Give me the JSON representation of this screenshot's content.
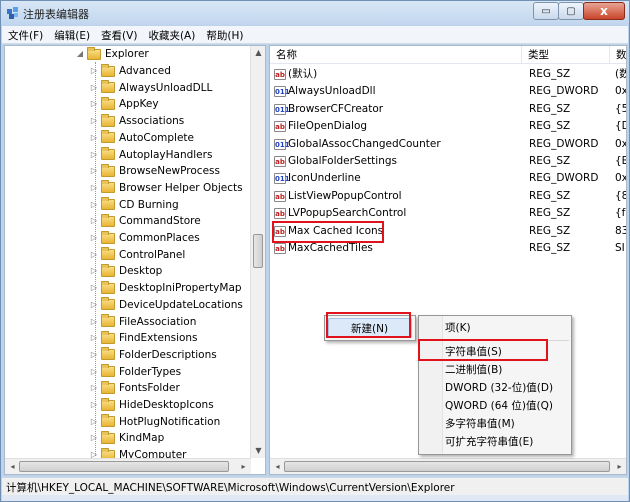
{
  "window": {
    "title": "注册表编辑器",
    "min_glyph": "▭",
    "max_glyph": "▢",
    "close_glyph": "x"
  },
  "menu": [
    "文件(F)",
    "编辑(E)",
    "查看(V)",
    "收藏夹(A)",
    "帮助(H)"
  ],
  "tree": {
    "root": "Explorer",
    "children": [
      "Advanced",
      "AlwaysUnloadDLL",
      "AppKey",
      "Associations",
      "AutoComplete",
      "AutoplayHandlers",
      "BrowseNewProcess",
      "Browser Helper Objects",
      "CD Burning",
      "CommandStore",
      "CommonPlaces",
      "ControlPanel",
      "Desktop",
      "DesktopIniPropertyMap",
      "DeviceUpdateLocations",
      "FileAssociation",
      "FindExtensions",
      "FolderDescriptions",
      "FolderTypes",
      "FontsFolder",
      "HideDesktopIcons",
      "HotPlugNotification",
      "KindMap",
      "MyComputer"
    ]
  },
  "columns": {
    "name": "名称",
    "type": "类型",
    "data": "数"
  },
  "values": [
    {
      "icon": "sz",
      "name": "(默认)",
      "type": "REG_SZ",
      "data": "(数"
    },
    {
      "icon": "dw",
      "name": "AlwaysUnloadDll",
      "type": "REG_DWORD",
      "data": "0x"
    },
    {
      "icon": "dw",
      "name": "BrowserCFCreator",
      "type": "REG_SZ",
      "data": "{5"
    },
    {
      "icon": "sz",
      "name": "FileOpenDialog",
      "type": "REG_SZ",
      "data": "{D"
    },
    {
      "icon": "dw",
      "name": "GlobalAssocChangedCounter",
      "type": "REG_DWORD",
      "data": "0x"
    },
    {
      "icon": "sz",
      "name": "GlobalFolderSettings",
      "type": "REG_SZ",
      "data": "{E"
    },
    {
      "icon": "dw",
      "name": "IconUnderline",
      "type": "REG_DWORD",
      "data": "0x"
    },
    {
      "icon": "sz",
      "name": "ListViewPopupControl",
      "type": "REG_SZ",
      "data": "{8"
    },
    {
      "icon": "sz",
      "name": "LVPopupSearchControl",
      "type": "REG_SZ",
      "data": "{fc"
    },
    {
      "icon": "sz",
      "name": "Max Cached Icons",
      "type": "REG_SZ",
      "data": "83"
    },
    {
      "icon": "sz",
      "name": "MaxCachedTiles",
      "type": "REG_SZ",
      "data": "SI"
    }
  ],
  "context_menu": {
    "new_label": "新建(N)",
    "arrow": "▸"
  },
  "submenu": {
    "key": "项(K)",
    "string": "字符串值(S)",
    "binary": "二进制值(B)",
    "dword": "DWORD (32-位)值(D)",
    "qword": "QWORD (64 位)值(Q)",
    "multi": "多字符串值(M)",
    "expand": "可扩充字符串值(E)"
  },
  "statusbar": "计算机\\HKEY_LOCAL_MACHINE\\SOFTWARE\\Microsoft\\Windows\\CurrentVersion\\Explorer",
  "icon_labels": {
    "sz": "ab",
    "dw": "011"
  },
  "colors": {
    "highlight_red": "#e0121b",
    "title_bg": "#c1d6ee"
  }
}
